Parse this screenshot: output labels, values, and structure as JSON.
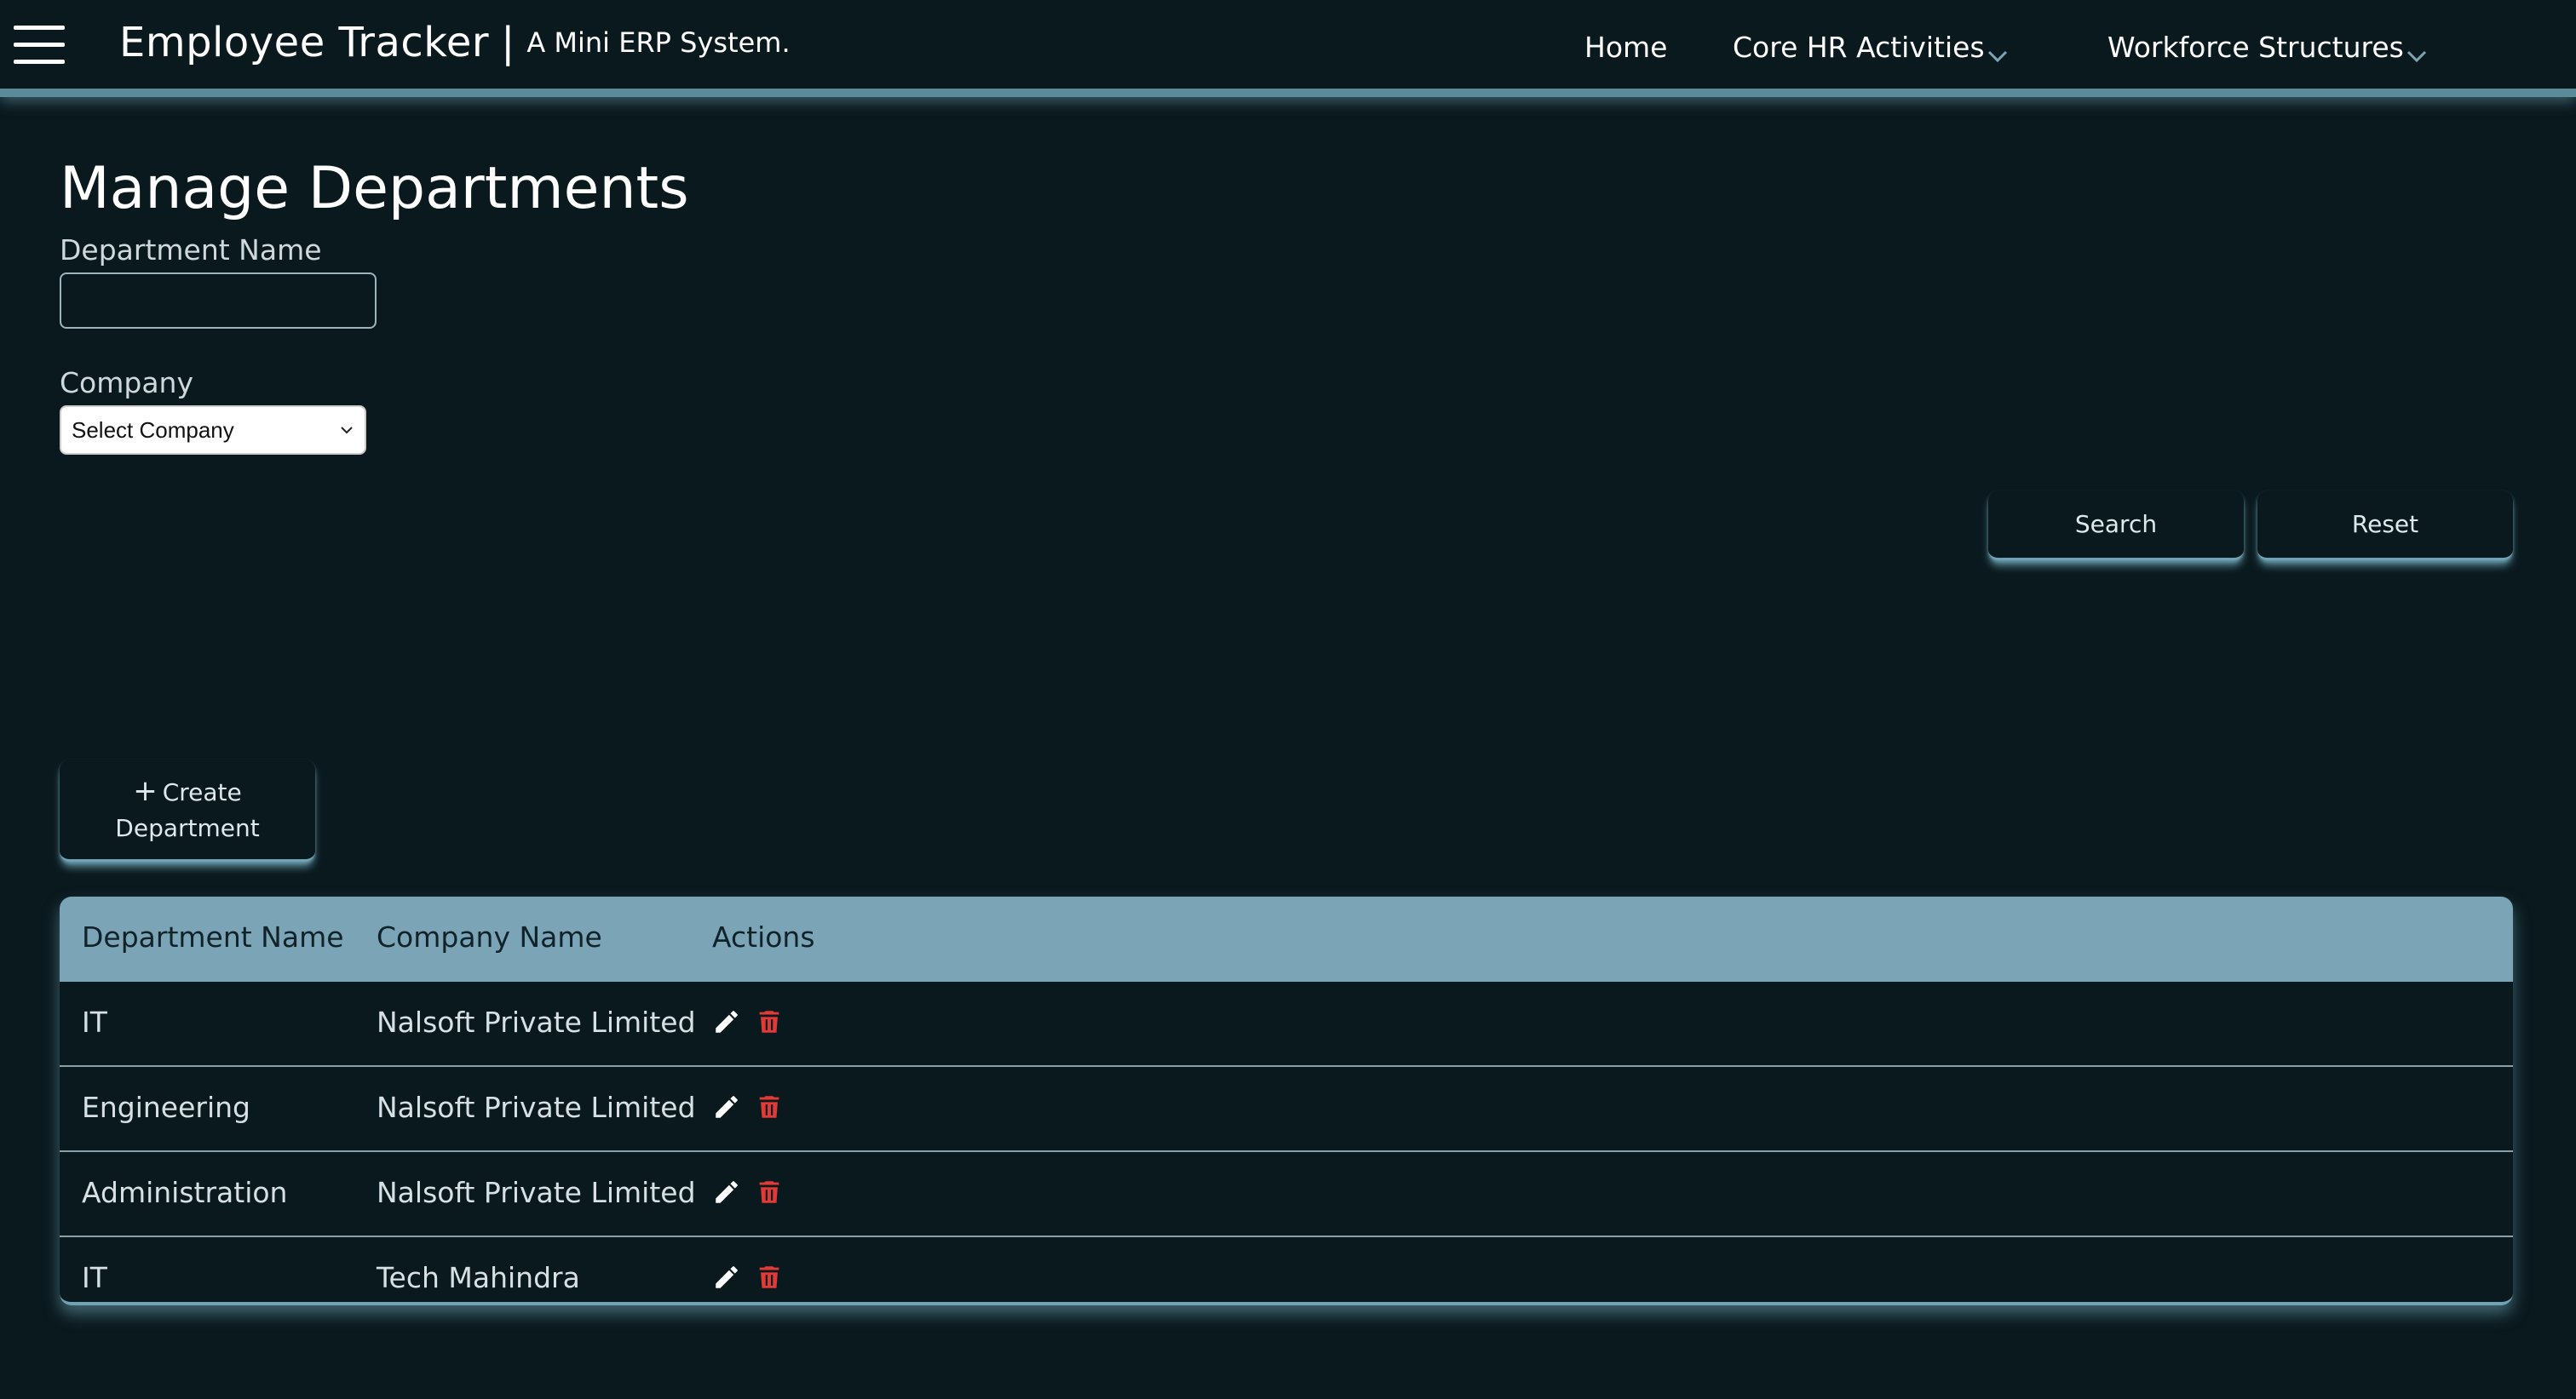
{
  "header": {
    "title": "Employee Tracker",
    "separator": "|",
    "subtitle": "A Mini ERP System.",
    "nav": {
      "home": "Home",
      "core_hr": "Core HR Activities",
      "workforce": "Workforce Structures"
    }
  },
  "page": {
    "title": "Manage Departments"
  },
  "filters": {
    "department_label": "Department Name",
    "department_value": "",
    "company_label": "Company",
    "company_selected": "Select Company"
  },
  "buttons": {
    "search": "Search",
    "reset": "Reset",
    "create_plus": "+",
    "create_line1": "Create",
    "create_line2": "Department"
  },
  "table": {
    "headers": [
      "Department Name",
      "Company Name",
      "Actions"
    ],
    "rows": [
      {
        "department": "IT",
        "company": "Nalsoft Private Limited"
      },
      {
        "department": "Engineering",
        "company": "Nalsoft Private Limited"
      },
      {
        "department": "Administration",
        "company": "Nalsoft Private Limited"
      },
      {
        "department": "IT",
        "company": "Tech Mahindra"
      }
    ]
  },
  "icons": {
    "menu": "hamburger-menu-icon",
    "chevron": "chevron-down-icon",
    "edit": "pencil-edit-icon",
    "delete": "trash-delete-icon"
  },
  "colors": {
    "background": "#0a191e",
    "accent": "#7ba4b6",
    "delete": "#e53935",
    "edit": "#ffffff"
  }
}
